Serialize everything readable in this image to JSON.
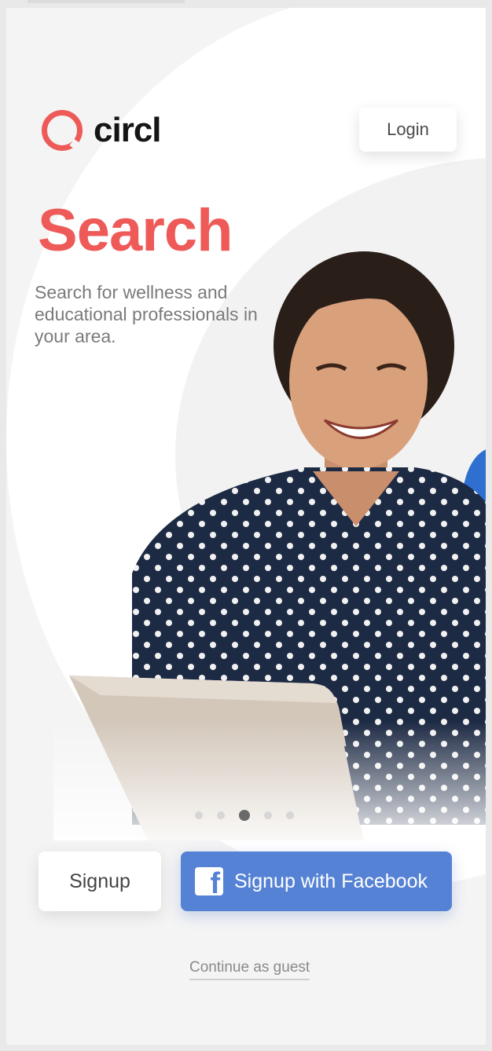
{
  "app": {
    "logo_text": "circl",
    "brand_color": "#ee5a58"
  },
  "header": {
    "login_label": "Login"
  },
  "hero": {
    "title": "Search",
    "subtitle": "Search for wellness and educational professionals in your area."
  },
  "carousel": {
    "total": 5,
    "active": 3
  },
  "actions": {
    "signup_label": "Signup",
    "facebook_label": "Signup with Facebook",
    "facebook_color": "#5582d4",
    "guest_label": "Continue as guest"
  }
}
